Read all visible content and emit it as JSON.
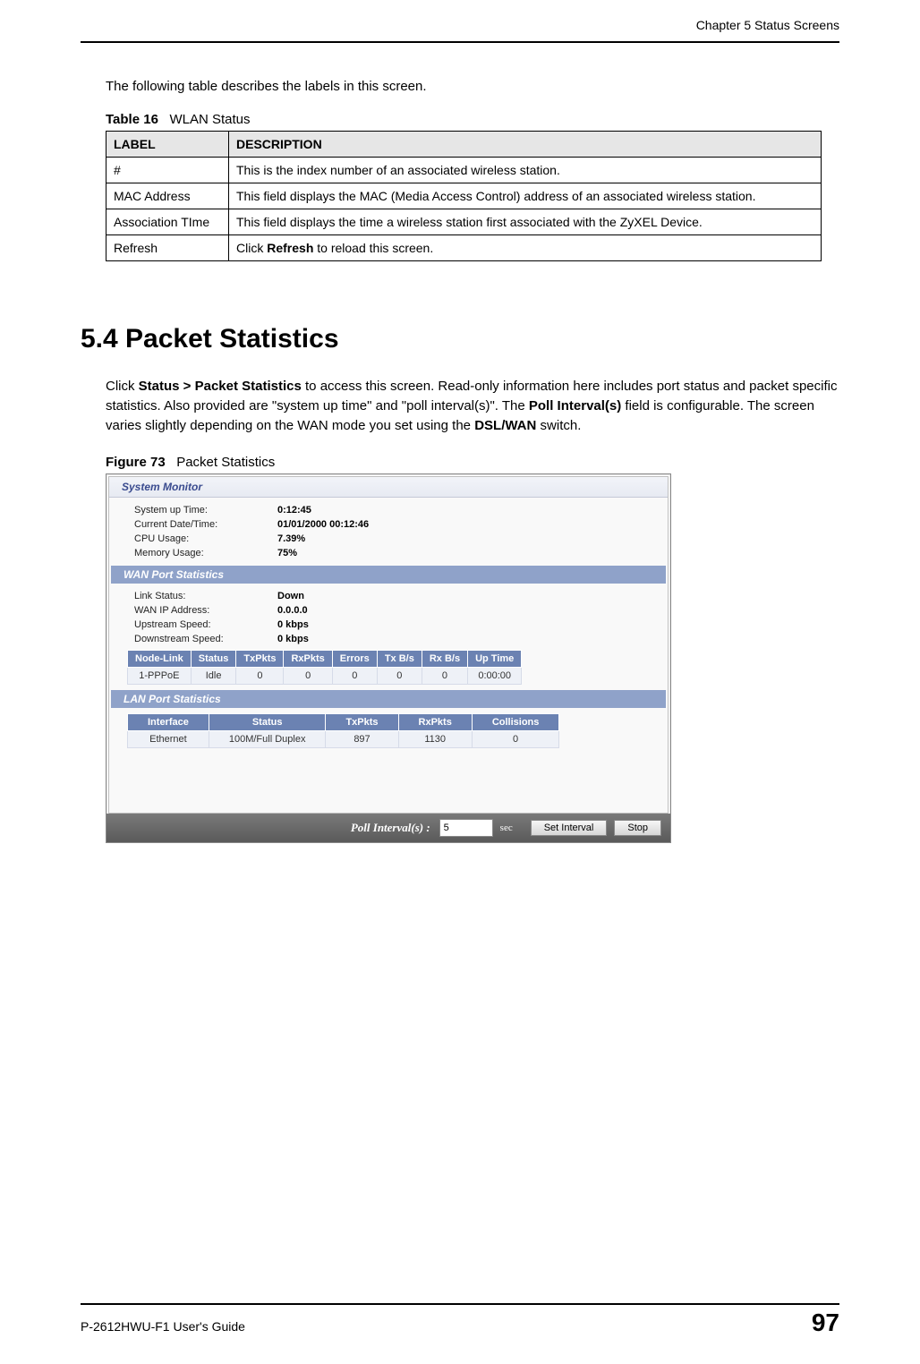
{
  "header": {
    "chapter": "Chapter 5 Status Screens"
  },
  "intro": "The following table describes the labels in this screen.",
  "table16": {
    "caption_num": "Table 16",
    "caption_title": "WLAN Status",
    "headers": {
      "label": "LABEL",
      "description": "DESCRIPTION"
    },
    "rows": [
      {
        "label": "#",
        "desc": "This is the index number of an associated wireless station."
      },
      {
        "label": "MAC Address",
        "desc": "This field displays the MAC (Media Access Control) address of an associated wireless station."
      },
      {
        "label": "Association TIme",
        "desc": "This field displays the time a wireless station first associated with the ZyXEL Device."
      },
      {
        "label": "Refresh",
        "desc_pre": "Click ",
        "desc_bold": "Refresh",
        "desc_post": " to reload this screen."
      }
    ]
  },
  "section": {
    "heading": "5.4  Packet Statistics",
    "p_pre": "Click ",
    "p_b1": "Status > Packet Statistics",
    "p_mid1": " to access this screen. Read-only information here includes port status and packet specific statistics. Also provided are \"system up time\" and \"poll interval(s)\". The ",
    "p_b2": "Poll Interval(s)",
    "p_mid2": " field is configurable. The screen varies slightly depending on the WAN mode you set using the ",
    "p_b3": "DSL/WAN",
    "p_post": " switch."
  },
  "figure": {
    "caption_num": "Figure 73",
    "caption_title": "Packet Statistics",
    "sysmon": {
      "title": "System Monitor",
      "rows": [
        {
          "k": "System up Time:",
          "v": "0:12:45"
        },
        {
          "k": "Current Date/Time:",
          "v": "01/01/2000   00:12:46"
        },
        {
          "k": "CPU Usage:",
          "v": "7.39%"
        },
        {
          "k": "Memory Usage:",
          "v": "75%"
        }
      ]
    },
    "wan": {
      "title": "WAN Port Statistics",
      "rows": [
        {
          "k": "Link Status:",
          "v": "Down"
        },
        {
          "k": "WAN IP Address:",
          "v": "0.0.0.0"
        },
        {
          "k": "Upstream Speed:",
          "v": "0 kbps"
        },
        {
          "k": "Downstream Speed:",
          "v": "0 kbps"
        }
      ],
      "table": {
        "headers": [
          "Node-Link",
          "Status",
          "TxPkts",
          "RxPkts",
          "Errors",
          "Tx B/s",
          "Rx B/s",
          "Up Time"
        ],
        "row": [
          "1-PPPoE",
          "Idle",
          "0",
          "0",
          "0",
          "0",
          "0",
          "0:00:00"
        ]
      }
    },
    "lan": {
      "title": "LAN Port Statistics",
      "table": {
        "headers": [
          "Interface",
          "Status",
          "TxPkts",
          "RxPkts",
          "Collisions"
        ],
        "row": [
          "Ethernet",
          "100M/Full Duplex",
          "897",
          "1130",
          "0"
        ]
      }
    },
    "bottomBar": {
      "label": "Poll Interval(s) :",
      "value": "5",
      "unit": "sec",
      "btn_set": "Set Interval",
      "btn_stop": "Stop"
    }
  },
  "footer": {
    "guide": "P-2612HWU-F1 User's Guide",
    "page": "97"
  }
}
